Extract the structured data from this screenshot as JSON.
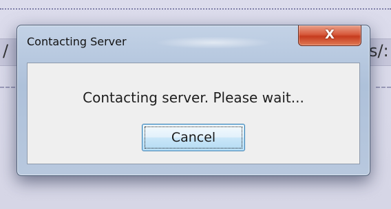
{
  "background": {
    "left_fragment": "/",
    "right_fragment": "s/:"
  },
  "dialog": {
    "title": "Contacting Server",
    "close_label": "X",
    "message": "Contacting server. Please wait...",
    "cancel_label": "Cancel"
  },
  "colors": {
    "close_button": "#d75a3c",
    "cancel_button_border": "#3c7fb1",
    "dialog_frame": "#aec1da",
    "content_background": "#efefef"
  },
  "icons": {
    "close": "close-icon"
  }
}
